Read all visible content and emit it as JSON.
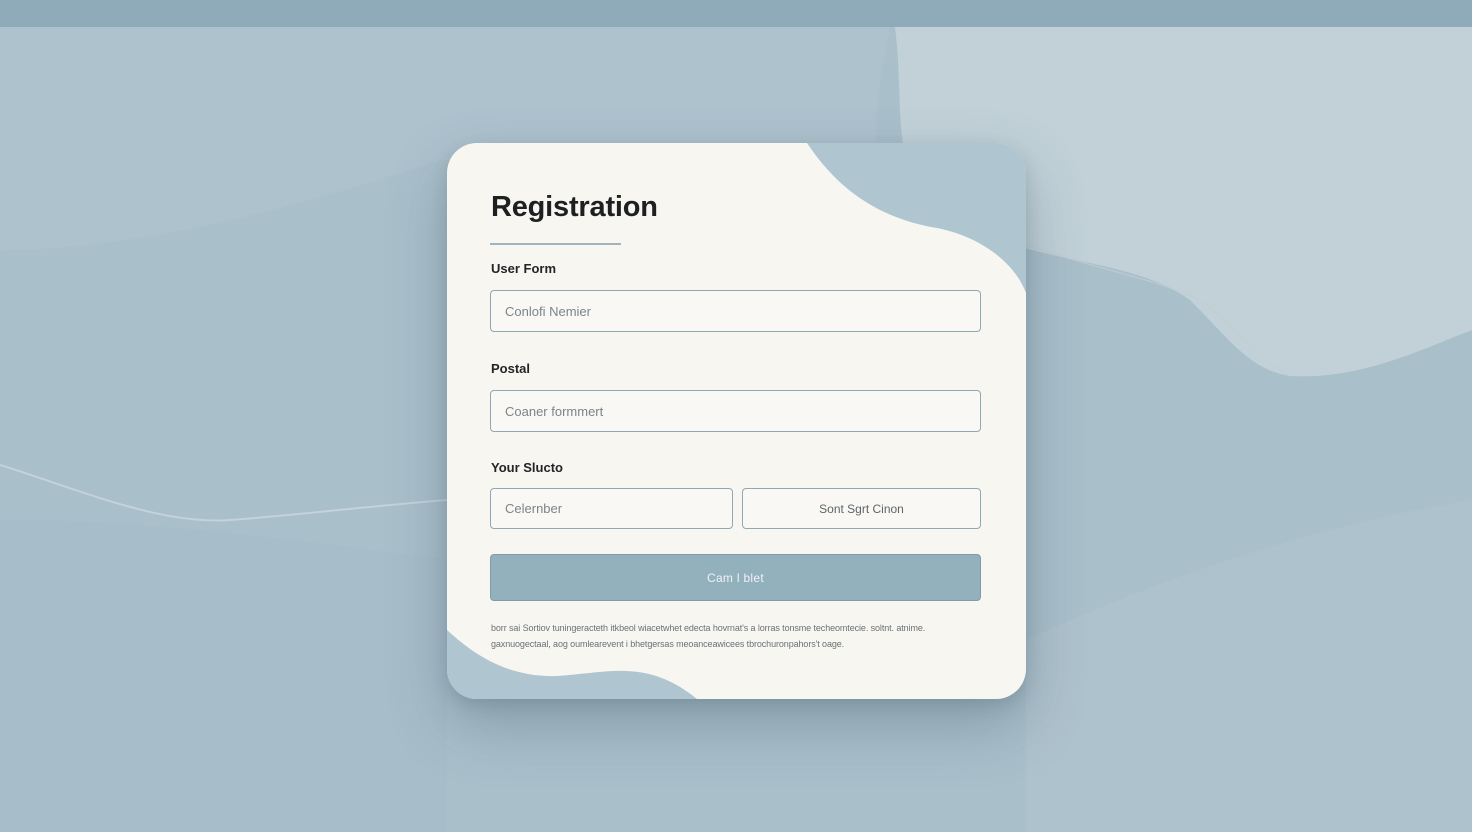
{
  "colors": {
    "background": "#a9bfca",
    "card": "#f7f6f1",
    "accent": "#93b0bd",
    "field_border": "#8ea8b6",
    "title_text": "#1d1f20"
  },
  "form": {
    "title": "Registration",
    "section_label": "User Form",
    "field1": {
      "placeholder": "Conlofi Nemier"
    },
    "label2": "Postal",
    "field2": {
      "placeholder": "Coaner formmert"
    },
    "label3": "Your Slucto",
    "field3": {
      "placeholder": "Celernber"
    },
    "secondary_button": "Sont Sgrt Cinon",
    "primary_button": "Cam l blet",
    "fine_print": "borr sai Sortiov tuningeracteth itkbeol wiacetwhet edecta hovrnat's a lorras tonsme techeomtecie. soltnt. atnime. gaxnuogectaal, aog oumlearevent i bhetgersas meoanceawicees tbrochuronpahors't oage."
  }
}
